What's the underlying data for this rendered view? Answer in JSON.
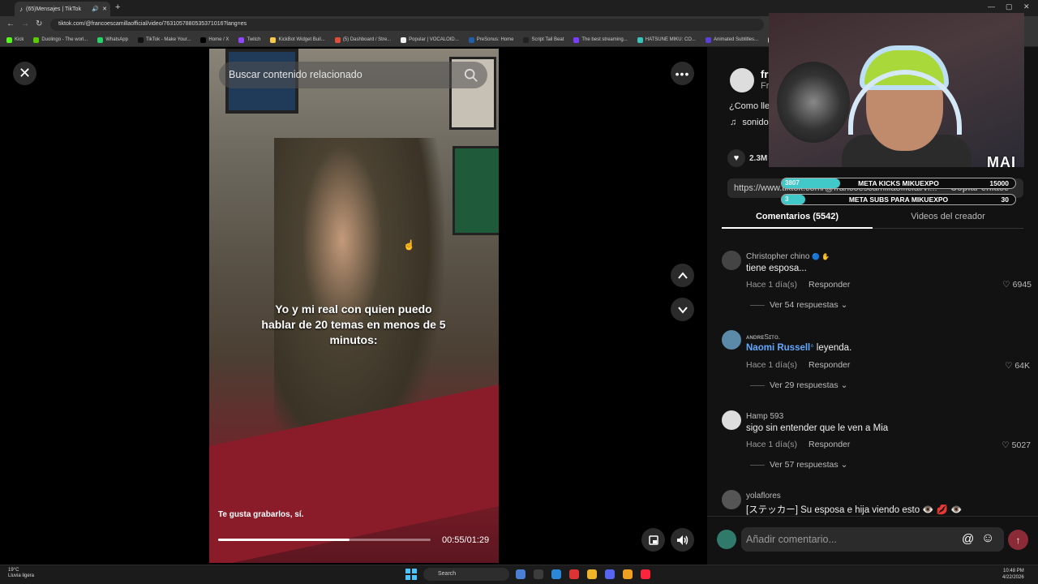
{
  "browser": {
    "tab_title": "(65)Mensajes | TikTok",
    "url": "tiktok.com/@francoescamillaofficial/video/7631057880535371016?lang=es",
    "bookmarks": [
      "Kick",
      "Duolingo - The worl...",
      "WhatsApp",
      "TikTok - Make Your...",
      "Home / X",
      "Twitch",
      "KickBot Widget Buil...",
      "(5) Dashboard / Stre...",
      "Popular | VOCALOID...",
      "PreSonus: Home",
      "Script Tail Beat",
      "The best streaming...",
      "HATSUNE MIKU: CO...",
      "Animated Subtitles...",
      "HATS"
    ],
    "bookmark_colors": [
      "#53fc18",
      "#58cc02",
      "#25d366",
      "#111111",
      "#000000",
      "#9146ff",
      "#f7c948",
      "#e04e39",
      "#f2f2f2",
      "#1f5ea8",
      "#222222",
      "#7a3cff",
      "#39c5bb",
      "#5b3fd6",
      "#cccccc"
    ]
  },
  "video": {
    "search_placeholder": "Buscar contenido relacionado",
    "caption": "Yo y mi real con quien puedo hablar de 20 temas en menos de 5 minutos:",
    "subtitle": "Te gusta grabarlos, sí.",
    "time": "00:55/01:29",
    "progress": 0.62
  },
  "creator": {
    "name": "fr",
    "sub": "Fr",
    "description": "¿Como lle",
    "music": "sonido",
    "likes": "2.3M",
    "link": "https://www.tiktok.com/@francoescamillaofficial/vi...",
    "copy_label": "Copiar enlace"
  },
  "tabs": {
    "comments": "Comentarios (5542)",
    "creator_videos": "Videos del creador"
  },
  "comments": [
    {
      "user": "Christopher chino",
      "badge": "🔵 ✋",
      "text": "tiene esposa...",
      "time": "Hace 1 día(s)",
      "reply": "Responder",
      "likes": "6945",
      "replies": "Ver 54 respuestas",
      "avatar": "#444"
    },
    {
      "user": "ᴀɴᴅʀᴇSɪᴛᴏ.",
      "mention": "Naomi Russell",
      "text": "leyenda.",
      "time": "Hace 1 día(s)",
      "reply": "Responder",
      "likes": "64K",
      "replies": "Ver 29 respuestas",
      "avatar": "#5a8aa8"
    },
    {
      "user": "Hamp 593",
      "text": "sigo sin entender que le ven a Mia",
      "time": "Hace 1 día(s)",
      "reply": "Responder",
      "likes": "5027",
      "replies": "Ver 57 respuestas",
      "avatar": "#dddddd"
    },
    {
      "user": "yolaflores",
      "text": "[ステッカー] Su esposa e hija viendo esto 👁️ 💋 👁️",
      "avatar": "#555"
    }
  ],
  "comment_input": {
    "placeholder": "Añadir comentario..."
  },
  "stream_overlay": {
    "brand": "MAI",
    "goals": [
      {
        "current": "3807",
        "label": "META KICKS MIKUEXPO",
        "max": "15000",
        "fill": 0.25
      },
      {
        "current": "3",
        "label": "META SUBS PARA MIKUEXPO",
        "max": "30",
        "fill": 0.1
      }
    ]
  },
  "taskbar": {
    "temp": "19°C",
    "weather": "Lluvia ligera",
    "search": "Search",
    "time": "10:48 PM",
    "date": "4/22/2026",
    "icon_colors": [
      "#4a7fd4",
      "#3c3c3c",
      "#2b88d8",
      "#d33",
      "#f0b429",
      "#5865f2",
      "#f0a020",
      "#fa243c"
    ]
  }
}
